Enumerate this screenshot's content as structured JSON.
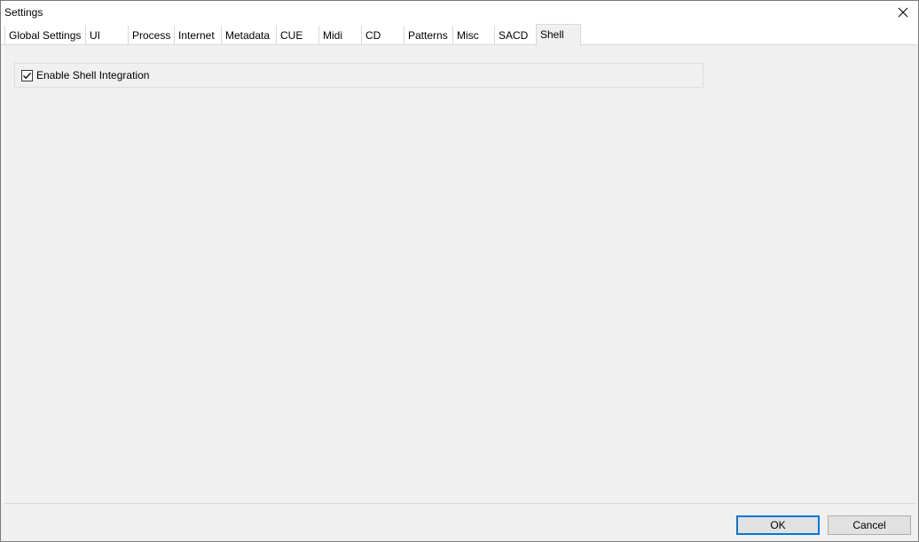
{
  "window": {
    "title": "Settings"
  },
  "tabs": [
    {
      "label": "Global Settings",
      "active": false
    },
    {
      "label": "UI",
      "active": false
    },
    {
      "label": "Process",
      "active": false
    },
    {
      "label": "Internet",
      "active": false
    },
    {
      "label": "Metadata",
      "active": false
    },
    {
      "label": "CUE",
      "active": false
    },
    {
      "label": "Midi",
      "active": false
    },
    {
      "label": "CD",
      "active": false
    },
    {
      "label": "Patterns",
      "active": false
    },
    {
      "label": "Misc",
      "active": false
    },
    {
      "label": "SACD",
      "active": false
    },
    {
      "label": "Shell",
      "active": true
    }
  ],
  "shell": {
    "enable_shell_integration": {
      "label": "Enable Shell Integration",
      "checked": true
    }
  },
  "buttons": {
    "ok_label": "OK",
    "cancel_label": "Cancel"
  },
  "colors": {
    "accent": "#0078d7",
    "panel": "#f0f0f0"
  },
  "icons": {
    "close": "close-icon",
    "check": "checkmark-icon"
  }
}
